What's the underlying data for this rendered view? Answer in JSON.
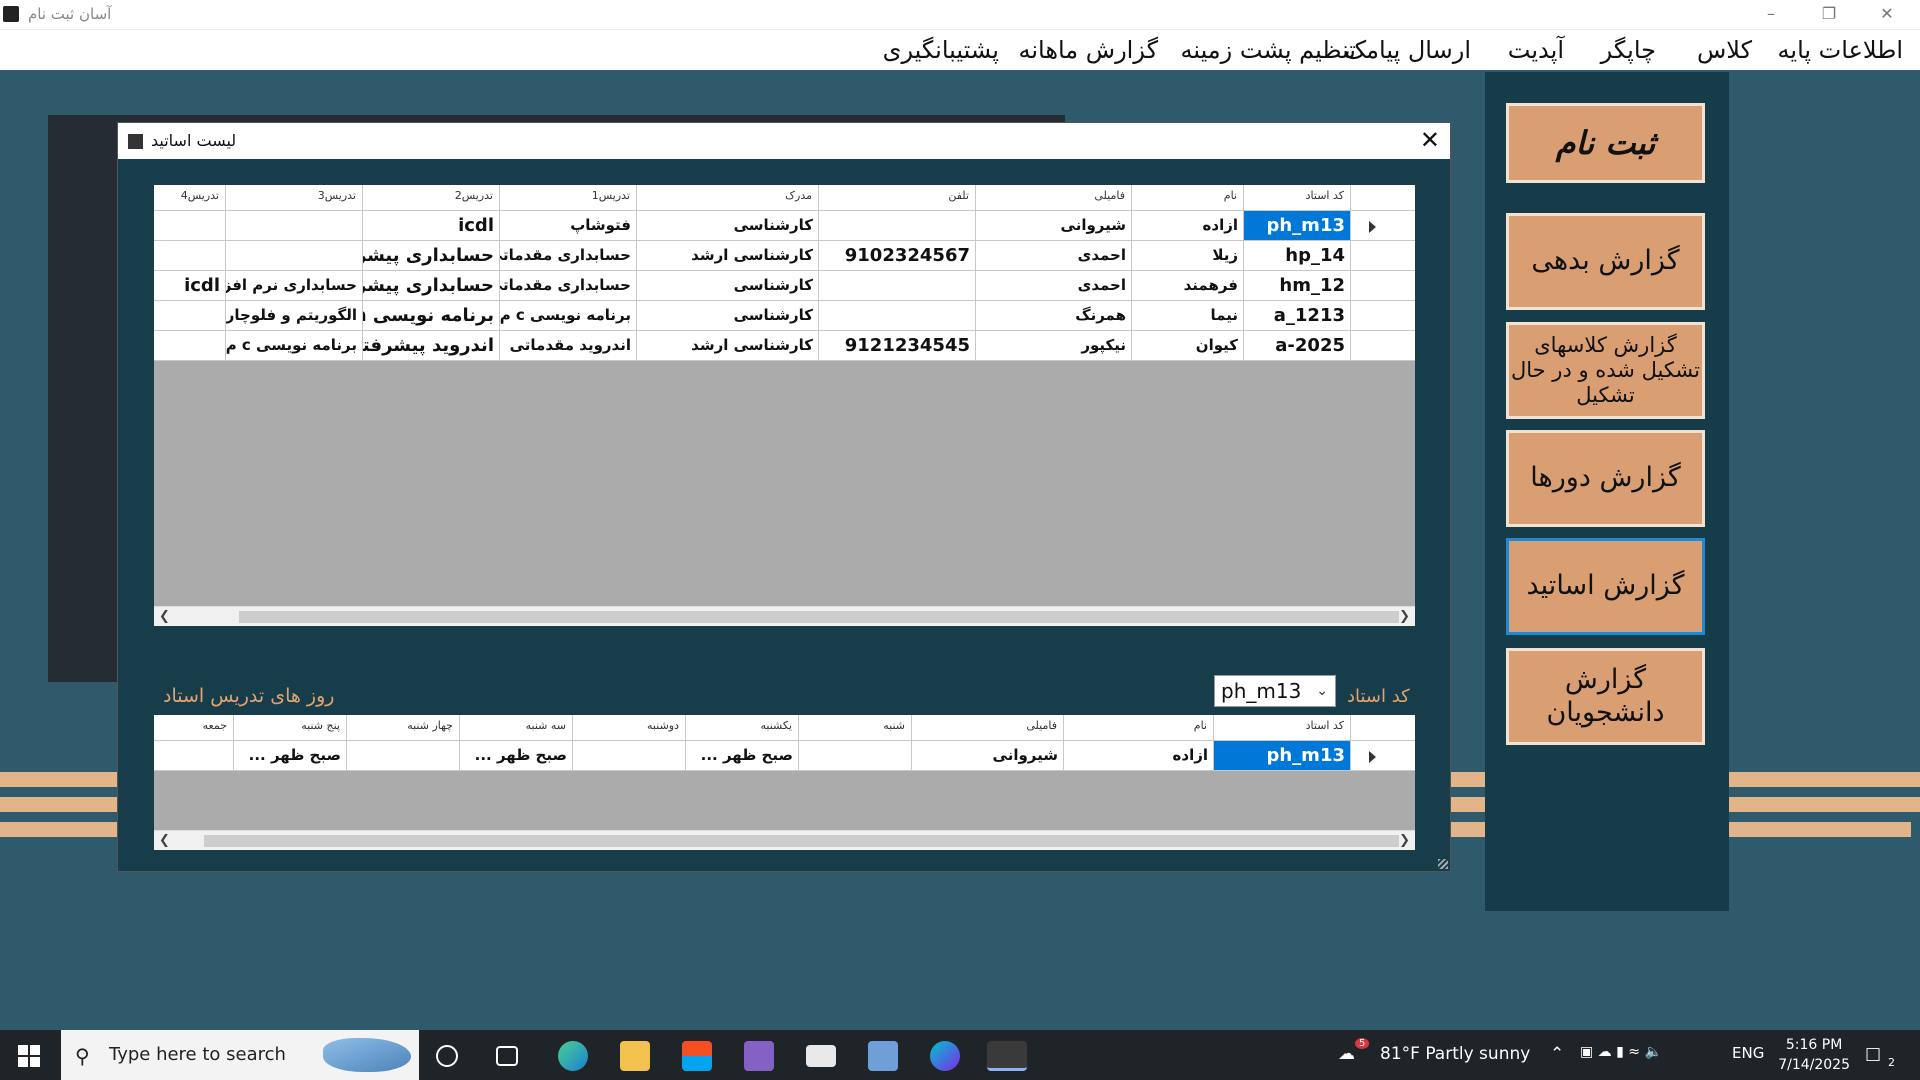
{
  "window": {
    "title": "آسان ثبت نام",
    "controls": [
      "–",
      "❐",
      "✕"
    ]
  },
  "menu": [
    "اطلاعات پایه",
    "کلاس",
    "چاپگر",
    "آپدیت",
    "ارسال پیامک",
    "تنظیم پشت زمینه",
    "گزارش ماهانه",
    "پشتیبانگیری"
  ],
  "sidebar": {
    "buttons": [
      "ثبت نام",
      "گزارش بدهی",
      "گزارش کلاسهای تشکیل شده و در حال تشکیل",
      "گزارش دورها",
      "گزارش اساتید",
      "گزارش دانشجویان"
    ]
  },
  "dialog": {
    "title": "لیست اساتید",
    "close": "✕",
    "teachers_table": {
      "columns": [
        "کد استاد",
        "نام",
        "فامیلی",
        "تلفن",
        "مدرک",
        "تدریس1",
        "تدریس2",
        "تدریس3",
        "تدریس4"
      ],
      "rows": [
        [
          "ph_m13",
          "ازاده",
          "شیروانی",
          "",
          "کارشناسی",
          "فتوشاپ",
          "icdl",
          "",
          ""
        ],
        [
          "hp_14",
          "زیلا",
          "احمدی",
          "9102324567",
          "کارشناسی ارشد",
          "حسابداری مقدماتی",
          "حسابداری پیشرفته",
          "",
          ""
        ],
        [
          "hm_12",
          "فرهمند",
          "احمدی",
          "",
          "کارشناسی",
          "حسابداری مقدماتی",
          "حسابداری پیشرفته",
          "حسابداری نرم افزار",
          "icdl"
        ],
        [
          "a_1213",
          "نیما",
          "همرنگ",
          "",
          "کارشناسی",
          "برنامه نویسی c م...",
          "برنامه نویسی java",
          "الگوریتم و فلوچارت",
          ""
        ],
        [
          "a-2025",
          "کیوان",
          "نیکپور",
          "9121234545",
          "کارشناسی ارشد",
          "اندروید مقدماتی",
          "اندروید پیشرفته",
          "برنامه نویسی c م...",
          ""
        ]
      ]
    },
    "teacher_code_label": "کد استاد",
    "teacher_code_value": "ph_m13",
    "days_label": "روز های تدریس استاد",
    "days_table": {
      "columns": [
        "کد استاد",
        "نام",
        "فامیلی",
        "شنبه",
        "یکشنبه",
        "دوشنبه",
        "سه شنبه",
        "چهار شنبه",
        "پنج شنبه",
        "جمعه"
      ],
      "rows": [
        [
          "ph_m13",
          "ازاده",
          "شیروانی",
          "",
          "صبح ظهر ...",
          "",
          "صبح ظهر ...",
          "",
          "صبح ظهر ...",
          ""
        ]
      ]
    }
  },
  "taskbar": {
    "search_placeholder": "Type here to search",
    "weather": "81°F  Partly sunny",
    "weather_badge": "5",
    "lang": "ENG",
    "time": "5:16 PM",
    "date": "7/14/2025",
    "notification_count": "2"
  },
  "colors": {
    "background": "#2e5a6b",
    "sidebar": "#173c49",
    "button": "#d99f73",
    "accent": "#0078d7",
    "label": "#e0a472"
  }
}
